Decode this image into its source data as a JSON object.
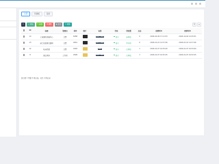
{
  "tabs": [
    {
      "label": "全部"
    },
    {
      "label": "待审核"
    },
    {
      "label": "显示"
    }
  ],
  "toolbar": {
    "buttons": [
      {
        "label": "+ 添加"
      },
      {
        "label": "✎ 编辑"
      },
      {
        "label": "✖ 删除"
      },
      {
        "label": "◉ 显示"
      },
      {
        "label": "⟳ 刷新"
      }
    ]
  },
  "tools_right": [
    "☰",
    "▾"
  ],
  "table": {
    "headers": [
      "",
      "ID",
      "标题",
      "管理员",
      "排序",
      "图片",
      "标签",
      "状态",
      "浏览量",
      "点击",
      "创建时间",
      "更新时间"
    ],
    "rows": [
      {
        "id": "14",
        "title": "上海国际金融中心",
        "admin": "订票",
        "weigh": "6288",
        "tags": [
          "默认",
          "推荐"
        ],
        "status": "显示",
        "views": "未审核",
        "clicks": "0",
        "created": "2024-02-09 17:11:53",
        "updated": "2024-10-04 12:45:51",
        "thumb": "dark"
      },
      {
        "id": "13",
        "title": "迪士尼故事互联网",
        "admin": "订票",
        "weigh": "4061",
        "tags": [
          "热门",
          "推荐"
        ],
        "status": "显示",
        "views": "不可用",
        "clicks": "0",
        "created": "2024-01-10 14:37:46",
        "updated": "2024-01-10 14:37:46",
        "thumb": "dark"
      },
      {
        "id": "12",
        "title": "杭州西湖",
        "admin": "订票",
        "weigh": "1826",
        "tags": [
          "推荐"
        ],
        "status": "显示",
        "views": "已审核",
        "clicks": "1",
        "created": "2024-01-07 16:54:40",
        "updated": "2024-01-07 16:54:40",
        "thumb": "yellow"
      },
      {
        "id": "8",
        "title": "黄山风景",
        "admin": "工作者",
        "weigh": "2999",
        "tags": [
          "默认",
          "推荐"
        ],
        "status": "显示",
        "views": "已审核",
        "clicks": "1",
        "created": "2024-01-07 16:52:25",
        "updated": "2024-01-07 16:52:25",
        "thumb": "yellow"
      }
    ]
  },
  "footer": {
    "text": "显示第 1 到第 4 条记录，总共 4 条记录"
  },
  "colors": {
    "accent": "#409eff",
    "status_green": "#3bb27a",
    "dark": "#2f3d4f"
  }
}
